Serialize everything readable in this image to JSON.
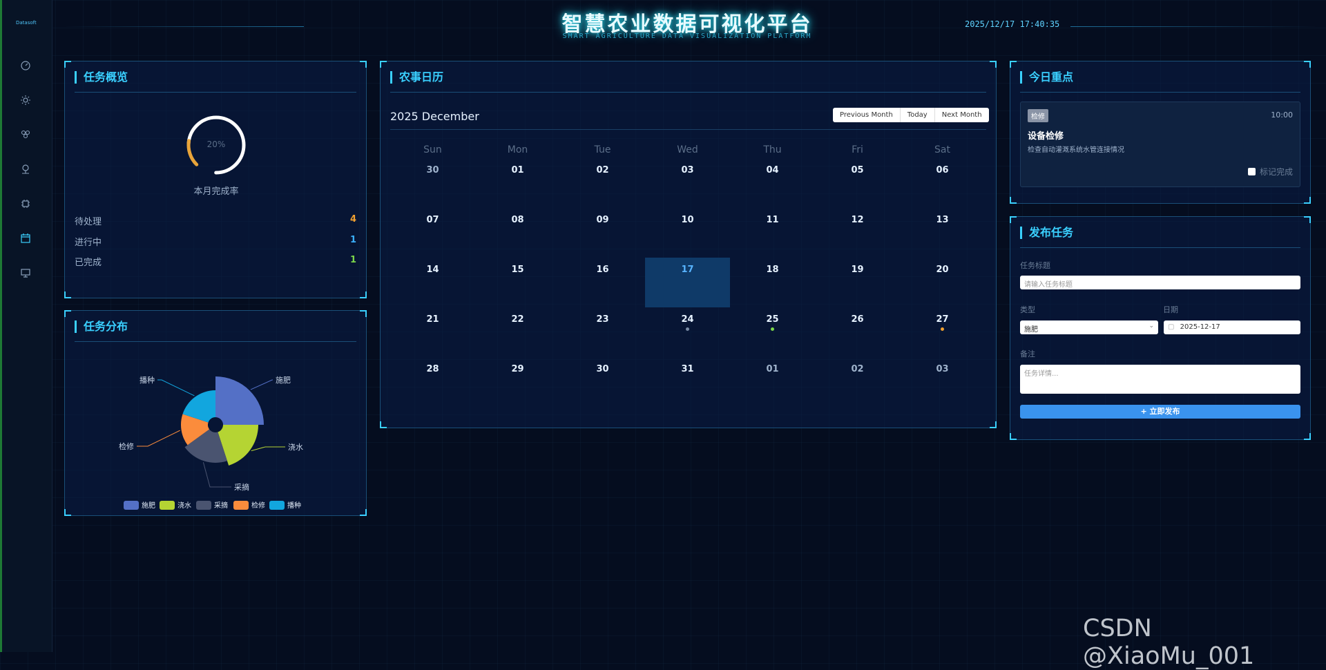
{
  "header": {
    "title": "智慧农业数据可视化平台",
    "subtitle": "SMART AGRICULTURE DATA VISUALIZATION PLATFORM",
    "datetime": "2025/12/17 17:40:35",
    "logo": "Datasoft"
  },
  "sidebar": {
    "items": [
      {
        "icon": "dashboard-icon"
      },
      {
        "icon": "sun-icon"
      },
      {
        "icon": "plant-icon"
      },
      {
        "icon": "location-icon"
      },
      {
        "icon": "chip-icon"
      },
      {
        "icon": "calendar-icon",
        "active": true
      },
      {
        "icon": "monitor-icon"
      }
    ]
  },
  "overview": {
    "title": "任务概览",
    "gauge_percent": "20%",
    "gauge_value": 0.2,
    "gauge_label": "本月完成率",
    "stats": [
      {
        "label": "待处理",
        "value": "4",
        "color": "#f0a030"
      },
      {
        "label": "进行中",
        "value": "1",
        "color": "#3ab0ff"
      },
      {
        "label": "已完成",
        "value": "1",
        "color": "#7bd64a"
      }
    ]
  },
  "distribution": {
    "title": "任务分布",
    "chart_data": {
      "type": "pie",
      "categories": [
        "施肥",
        "浇水",
        "采摘",
        "检修",
        "播种"
      ],
      "values": [
        25,
        20,
        20,
        15,
        20
      ],
      "colors": [
        "#5470c6",
        "#b5d433",
        "#4a5470",
        "#fb8c3c",
        "#12a6de"
      ],
      "legend": "bottom"
    }
  },
  "calendar": {
    "title": "农事日历",
    "month_label": "2025 December",
    "buttons": [
      "Previous Month",
      "Today",
      "Next Month"
    ],
    "weekdays": [
      "Sun",
      "Mon",
      "Tue",
      "Wed",
      "Thu",
      "Fri",
      "Sat"
    ],
    "weeks": [
      [
        "30",
        "01",
        "02",
        "03",
        "04",
        "05",
        "06"
      ],
      [
        "07",
        "08",
        "09",
        "10",
        "11",
        "12",
        "13"
      ],
      [
        "14",
        "15",
        "16",
        "17",
        "18",
        "19",
        "20"
      ],
      [
        "21",
        "22",
        "23",
        "24",
        "25",
        "26",
        "27"
      ],
      [
        "28",
        "29",
        "30",
        "31",
        "01",
        "02",
        "03"
      ]
    ]
  },
  "today_focus": {
    "title": "今日重点",
    "task": {
      "tag": "检修",
      "time": "10:00",
      "name": "设备检修",
      "desc": "检查自动灌溉系统水管连接情况",
      "check_label": "标记完成"
    }
  },
  "publish": {
    "title": "发布任务",
    "title_label": "任务标题",
    "title_placeholder": "请输入任务标题",
    "type_label": "类型",
    "type_value": "施肥",
    "date_label": "日期",
    "date_value": "2025-12-17",
    "note_label": "备注",
    "note_placeholder": "任务详情...",
    "submit_label": "+ 立即发布"
  },
  "watermark": "CSDN @XiaoMu_001"
}
